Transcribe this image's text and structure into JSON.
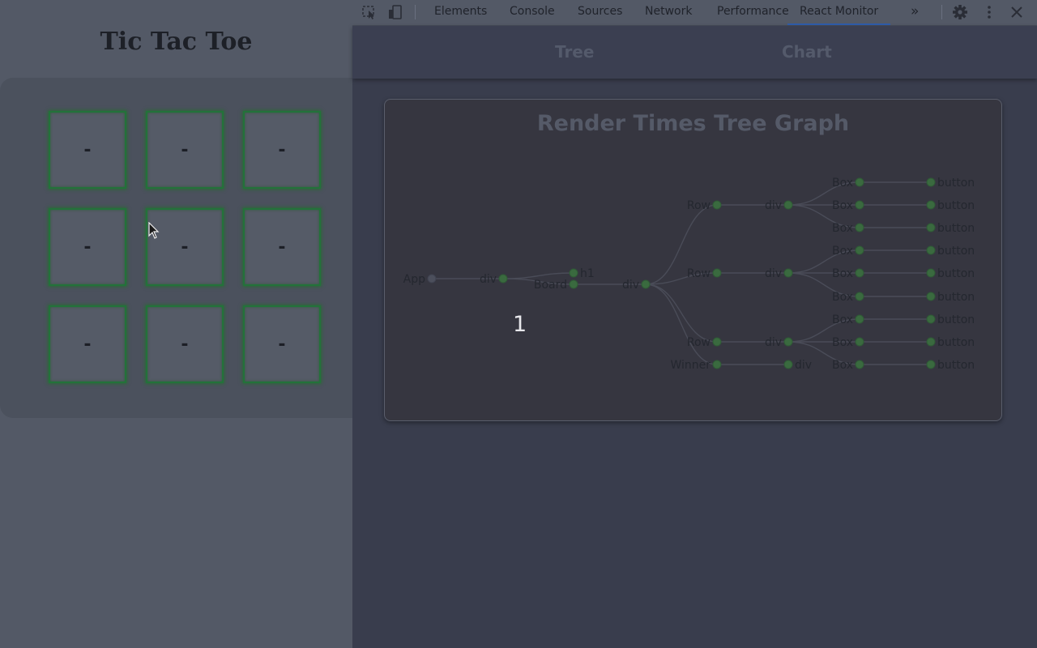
{
  "page": {
    "title": "Tic Tac Toe",
    "cells": [
      "-",
      "-",
      "-",
      "-",
      "-",
      "-",
      "-",
      "-",
      "-"
    ]
  },
  "devtools": {
    "tabs": [
      "Elements",
      "Console",
      "Sources",
      "Network",
      "Performance",
      "React Monitor"
    ],
    "active_tab": "React Monitor",
    "more_tabs_glyph": "»"
  },
  "react_monitor": {
    "nav": {
      "tree": "Tree",
      "chart": "Chart"
    },
    "graph": {
      "title": "Render Times Tree Graph",
      "render_count": "1",
      "nodes": {
        "app": "App",
        "div": "div",
        "h1": "h1",
        "board": "Board",
        "row": "Row",
        "box": "Box",
        "button": "button",
        "winner": "Winner"
      }
    }
  },
  "colors": {
    "page_bg": "#535966",
    "cell_border": "#23723a",
    "devtools_bg": "#393d4d",
    "node_fill": "#3a6a3f",
    "active_tab_underline": "#2f5dac"
  }
}
